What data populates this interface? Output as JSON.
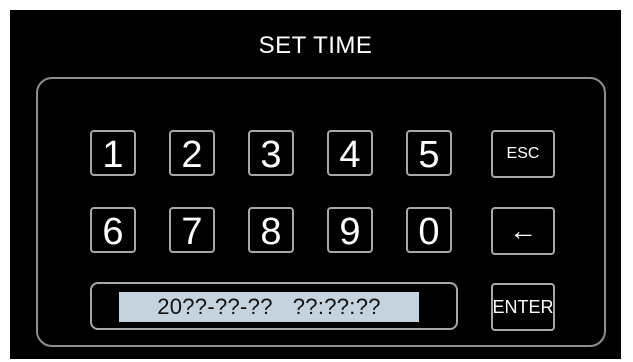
{
  "title": "SET TIME",
  "keypad": {
    "row1": [
      "1",
      "2",
      "3",
      "4",
      "5"
    ],
    "row2": [
      "6",
      "7",
      "8",
      "9",
      "0"
    ],
    "esc_label": "ESC",
    "backspace_label": "←",
    "enter_label": "ENTER"
  },
  "display": {
    "date": "20??-??-??",
    "time": "??:??:??"
  },
  "colors": {
    "background": "#000000",
    "display_fill": "#c5d3de",
    "key_border": "#a8a8a8",
    "text": "#ffffff"
  }
}
